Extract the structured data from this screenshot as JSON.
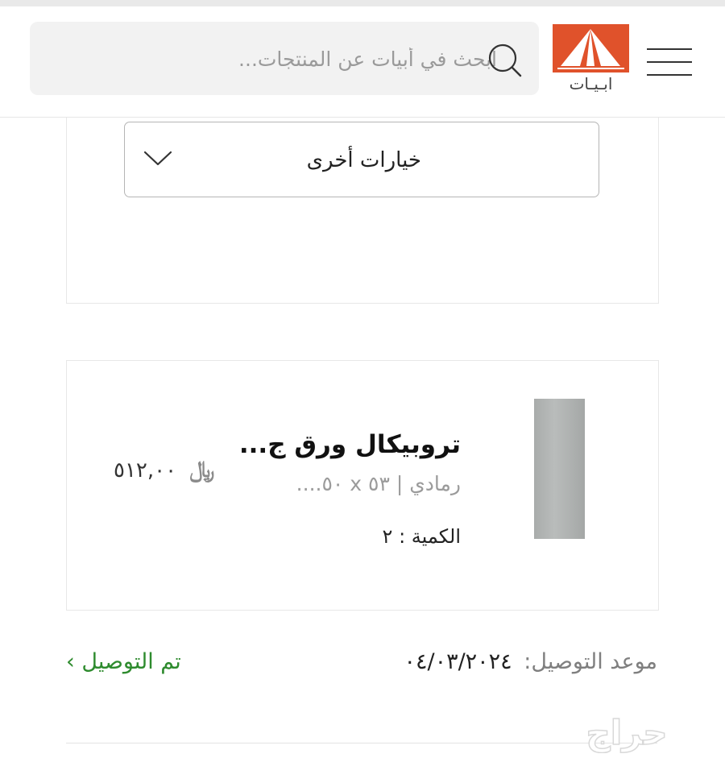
{
  "header": {
    "search_placeholder": "ابحث في أبيات عن المنتجات...",
    "logo_text": "ابـيـات",
    "brand_color": "#e0522b"
  },
  "options_card": {
    "dropdown_label": "خيارات أخرى"
  },
  "product": {
    "title": "تروبيكال ورق ج...",
    "variant": "رمادي | ٥٣ x ٥٠....",
    "quantity": "الكمية : ٢",
    "price": "٥١٢,٠٠",
    "currency_symbol": "﷼"
  },
  "delivery": {
    "label": "موعد التوصيل:",
    "date": "٠٤/٠٣/٢٠٢٤",
    "status": "تم التوصيل ›",
    "status_color": "#2e8b2e"
  },
  "watermark": "حراج"
}
